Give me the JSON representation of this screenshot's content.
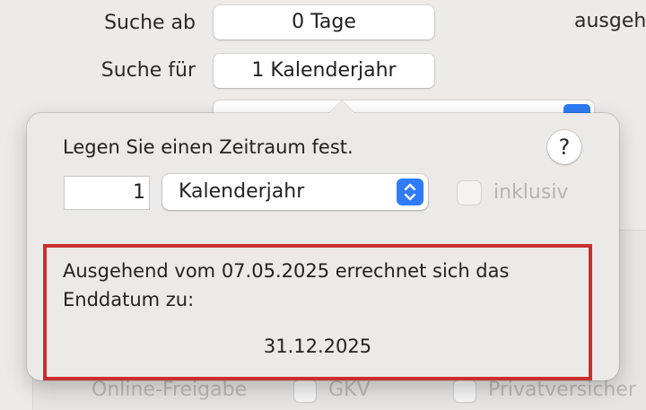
{
  "form": {
    "search_from_label": "Suche ab",
    "search_from_value": "0 Tage",
    "search_for_label": "Suche für",
    "search_for_value": "1 Kalenderjahr",
    "right_label_partial": "ausgeh"
  },
  "popover": {
    "title": "Legen Sie einen Zeitraum fest.",
    "help_label": "?",
    "quantity": "1",
    "unit_selected": "Kalenderjahr",
    "inklusiv_label": "inklusiv",
    "inklusiv_checked": false,
    "result_text": "Ausgehend vom 07.05.2025 errechnet sich das Enddatum zu:",
    "result_date": "31.12.2025"
  },
  "background_row": {
    "online_label": "Online-Freigabe",
    "gkv_label": "GKV",
    "private_label": "Privatversicher"
  },
  "colors": {
    "accent": "#2f7cf6",
    "highlight_border": "#c9302f",
    "window_bg": "#ecebea"
  }
}
